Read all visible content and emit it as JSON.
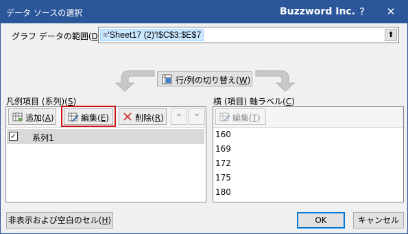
{
  "window": {
    "title": "データ ソースの選択",
    "brand": "Buzzword Inc.",
    "help_glyph": "?",
    "close_glyph": "✕"
  },
  "range": {
    "label_prefix": "グラフ データの範囲(",
    "label_key": "D",
    "label_suffix": "):",
    "value": "='Sheet17 (2)'!$C$3:$E$7",
    "collapse_glyph": "⬆"
  },
  "swap_button": {
    "label": "行/列の切り替え(",
    "key": "W",
    "suffix": ")"
  },
  "legend_panel": {
    "heading_prefix": "凡例項目 (系列)(",
    "heading_key": "S",
    "heading_suffix": ")",
    "add": {
      "label": "追加(",
      "key": "A",
      "suffix": ")"
    },
    "edit": {
      "label": "編集(",
      "key": "E",
      "suffix": ")"
    },
    "delete": {
      "label": "削除(",
      "key": "R",
      "suffix": ")"
    },
    "move_up_glyph": "⌃",
    "move_down_glyph": "⌄",
    "series": [
      {
        "checked": true,
        "check_glyph": "✓",
        "name": "系列1"
      }
    ]
  },
  "axis_panel": {
    "heading_prefix": "横 (項目) 軸ラベル(",
    "heading_key": "C",
    "heading_suffix": ")",
    "edit": {
      "label": "編集(",
      "key": "T",
      "suffix": ")"
    },
    "categories": [
      "160",
      "169",
      "172",
      "175",
      "180"
    ]
  },
  "footer": {
    "hidden_cells": {
      "label": "非表示および空白のセル(",
      "key": "H",
      "suffix": ")"
    },
    "ok_label": "OK",
    "cancel_label": "キャンセル"
  }
}
